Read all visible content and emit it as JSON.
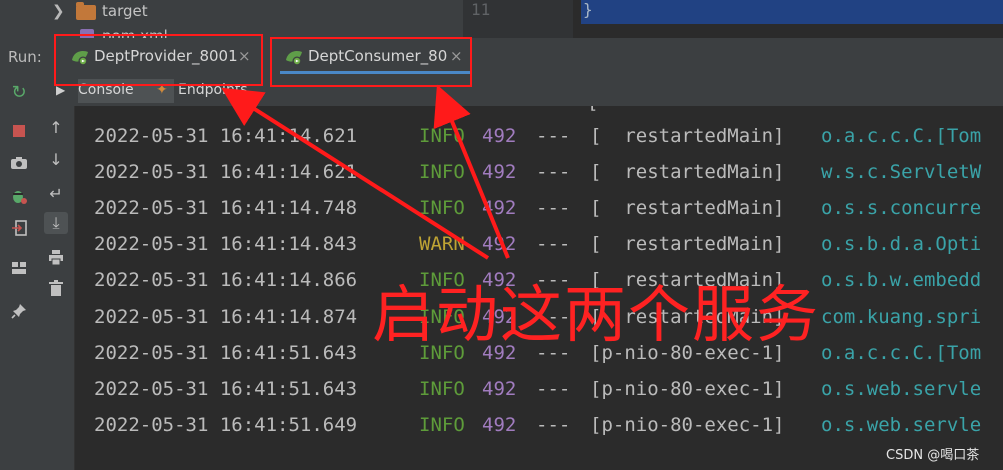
{
  "tree": {
    "folder_name": "target",
    "file_name": "pom.xml"
  },
  "editor": {
    "line_number": "11",
    "code": "}"
  },
  "run": {
    "label": "Run:",
    "tabs": [
      {
        "name": "DeptProvider_8001",
        "close": "×"
      },
      {
        "name": "DeptConsumer_80",
        "close": "×"
      }
    ],
    "subtabs": {
      "console": "Console",
      "endpoints": "Endpoints"
    }
  },
  "toolbar_icons": [
    "rerun-icon",
    "stop-icon",
    "camera-icon",
    "debug-icon",
    "exit-icon",
    "layout-icon",
    "pin-icon"
  ],
  "toolbar2_icons": [
    "up-arrow-icon",
    "down-arrow-icon",
    "soft-wrap-icon",
    "scroll-to-end-icon",
    "print-icon",
    "trash-icon"
  ],
  "log": {
    "rows": [
      {
        "ts": "2022-05-31 16:41:14.621",
        "level": "INFO",
        "pid": "492",
        "sep": "---",
        "thread": "[  restartedMain]",
        "logger": "o.a.c.c.C.[Tom"
      },
      {
        "ts": "2022-05-31 16:41:14.621",
        "level": "INFO",
        "pid": "492",
        "sep": "---",
        "thread": "[  restartedMain]",
        "logger": "w.s.c.ServletW"
      },
      {
        "ts": "2022-05-31 16:41:14.748",
        "level": "INFO",
        "pid": "492",
        "sep": "---",
        "thread": "[  restartedMain]",
        "logger": "o.s.s.concurre"
      },
      {
        "ts": "2022-05-31 16:41:14.843",
        "level": "WARN",
        "pid": "492",
        "sep": "---",
        "thread": "[  restartedMain]",
        "logger": "o.s.b.d.a.Opti"
      },
      {
        "ts": "2022-05-31 16:41:14.866",
        "level": "INFO",
        "pid": "492",
        "sep": "---",
        "thread": "[  restartedMain]",
        "logger": "o.s.b.w.embedd"
      },
      {
        "ts": "2022-05-31 16:41:14.874",
        "level": "INFO",
        "pid": "492",
        "sep": "---",
        "thread": "[  restartedMain]",
        "logger": "com.kuang.spri"
      },
      {
        "ts": "2022-05-31 16:41:51.643",
        "level": "INFO",
        "pid": "492",
        "sep": "---",
        "thread": "[p-nio-80-exec-1]",
        "logger": "o.a.c.c.C.[Tom"
      },
      {
        "ts": "2022-05-31 16:41:51.643",
        "level": "INFO",
        "pid": "492",
        "sep": "---",
        "thread": "[p-nio-80-exec-1]",
        "logger": "o.s.web.servle"
      },
      {
        "ts": "2022-05-31 16:41:51.649",
        "level": "INFO",
        "pid": "492",
        "sep": "---",
        "thread": "[p-nio-80-exec-1]",
        "logger": "o.s.web.servle"
      }
    ]
  },
  "annotation": {
    "text": "启动这两个服务",
    "color": "#ff1a1a"
  },
  "watermark": "CSDN @喝口茶",
  "colors": {
    "info": "#5e9c3a",
    "warn": "#bfa434",
    "pid": "#a17cbf",
    "logger": "#3aa3a8"
  }
}
